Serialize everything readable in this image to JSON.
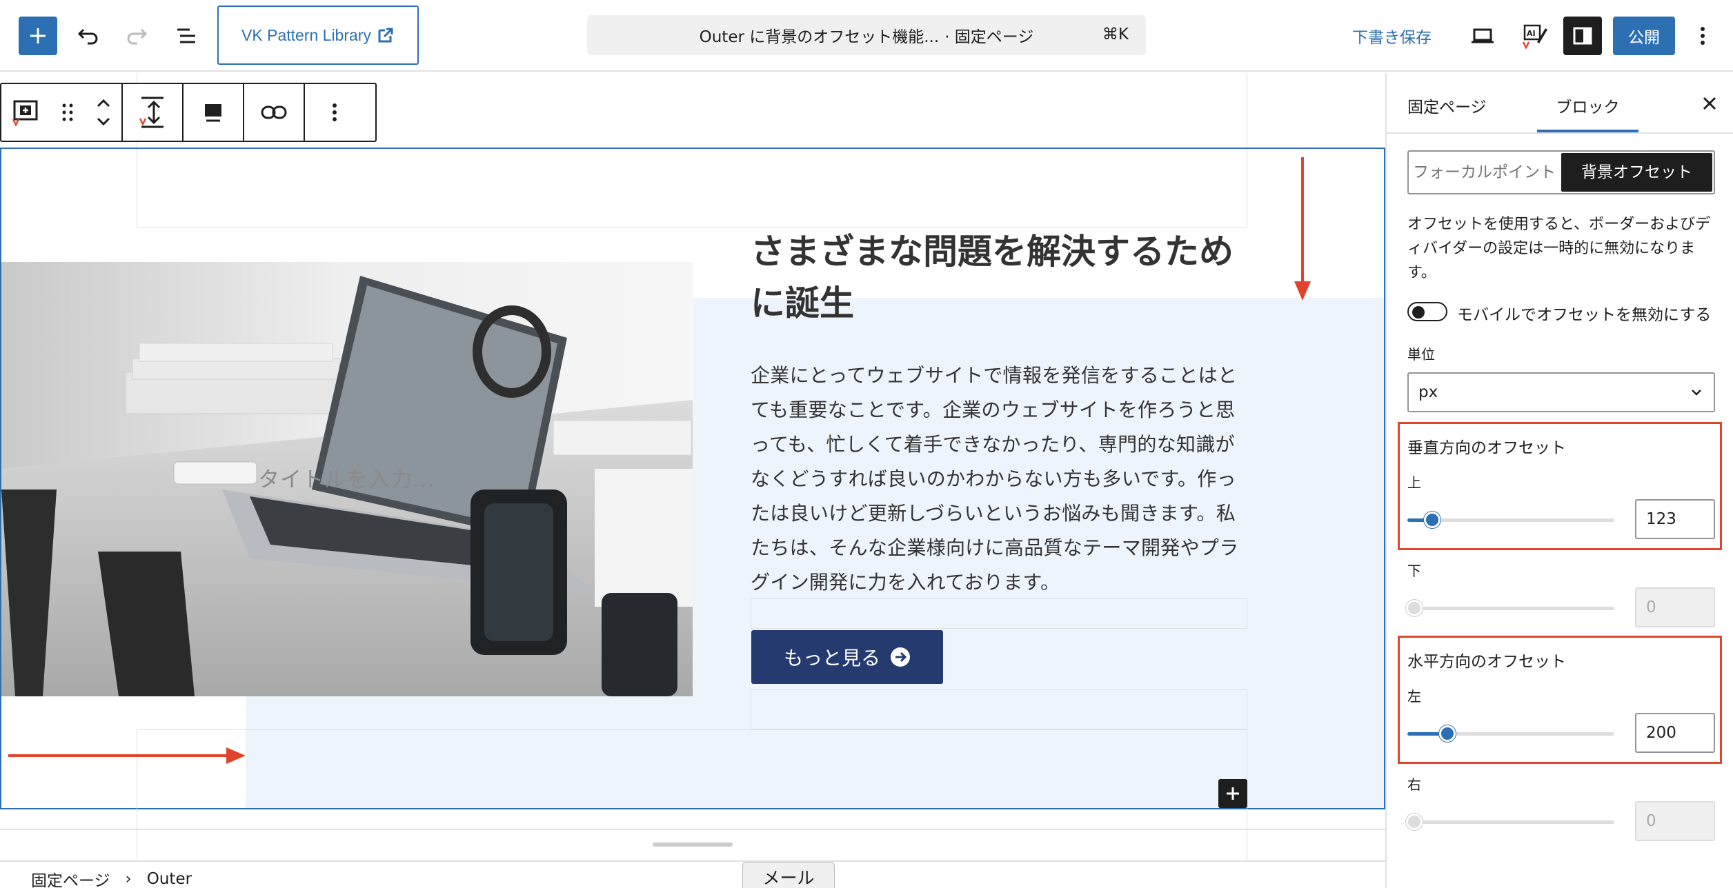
{
  "topbar": {
    "pattern_library_label": "VK Pattern Library",
    "command_title": "Outer に背景のオフセット機能...",
    "command_type": "· 固定ページ",
    "command_shortcut": "⌘K",
    "save_draft_label": "下書き保存",
    "publish_label": "公開"
  },
  "canvas": {
    "heading": "さまざまな問題を解決するために誕生",
    "body": "企業にとってウェブサイトで情報を発信をすることはとても重要なことです。企業のウェブサイトを作ろうと思っても、忙しくて着手できなかったり、専門的な知識がなくどうすれば良いのかわからない方も多いです。作ったは良いけど更新しづらいというお悩みも聞きます。私たちは、そんな企業様向けに高品質なテーマ開発やプラグイン開発に力を入れております。",
    "button_label": "もっと見る",
    "image_placeholder": "タイトルを入力..."
  },
  "breadcrumb": {
    "items": [
      "固定ページ",
      "Outer"
    ]
  },
  "mail_tab_label": "メール",
  "sidebar": {
    "tabs": [
      "固定ページ",
      "ブロック"
    ],
    "active_tab": "ブロック",
    "segments": [
      "フォーカルポイント",
      "背景オフセット"
    ],
    "active_segment": "背景オフセット",
    "note": "オフセットを使用すると、ボーダーおよびディバイダーの設定は一時的に無効になります。",
    "mobile_toggle_label": "モバイルでオフセットを無効にする",
    "unit_label": "単位",
    "unit_value": "px",
    "vertical": {
      "title": "垂直方向のオフセット",
      "top_label": "上",
      "top_value": "123",
      "bottom_label": "下",
      "bottom_value": "0"
    },
    "horizontal": {
      "title": "水平方向のオフセット",
      "left_label": "左",
      "left_value": "200",
      "right_label": "右",
      "right_value": "0"
    }
  },
  "colors": {
    "accent": "#2c6fb3",
    "button_bg": "#253a6e",
    "offset_bg": "#edf4fc",
    "annotation": "#e2432c"
  }
}
